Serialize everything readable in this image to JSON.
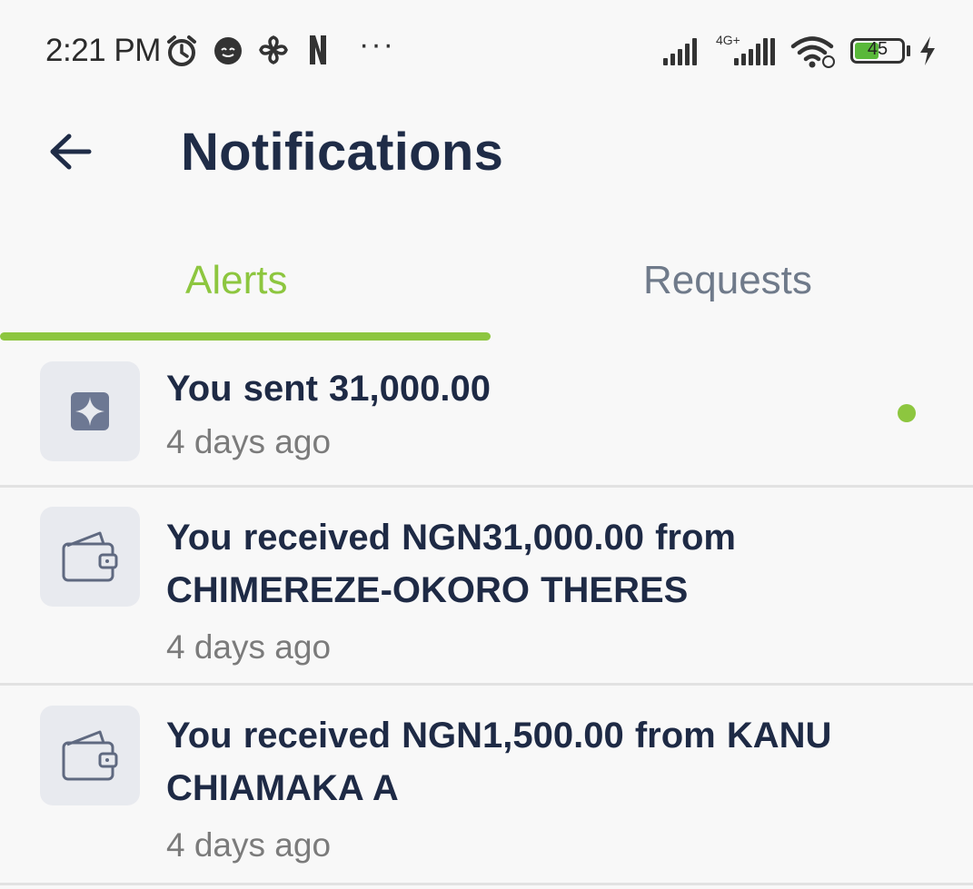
{
  "status_bar": {
    "time": "2:21 PM",
    "network_label": "4G+",
    "battery_level": "45",
    "icons": [
      "alarm-icon",
      "face-icon",
      "pinwheel-icon",
      "netflix-icon",
      "more-dots-icon",
      "signal-icon",
      "signal-icon-2",
      "wifi-icon",
      "battery-icon",
      "charging-icon"
    ],
    "more": "···"
  },
  "header": {
    "title": "Notifications",
    "back_icon": "back-arrow-icon"
  },
  "tabs": [
    {
      "label": "Alerts",
      "active": true
    },
    {
      "label": "Requests",
      "active": false
    }
  ],
  "colors": {
    "accent": "#8dc63f",
    "title": "#1f2c47",
    "muted": "#7b7b7b"
  },
  "notifications": [
    {
      "message": "You sent 31,000.00",
      "time": "4 days ago",
      "icon": "sparkle-icon",
      "unread": true
    },
    {
      "message": "You received NGN31,000.00  from CHIMEREZE-OKORO THERES",
      "time": "4 days ago",
      "icon": "wallet-icon",
      "unread": false
    },
    {
      "message": "You received NGN1,500.00  from KANU CHIAMAKA A",
      "time": "4 days ago",
      "icon": "wallet-icon",
      "unread": false
    }
  ]
}
